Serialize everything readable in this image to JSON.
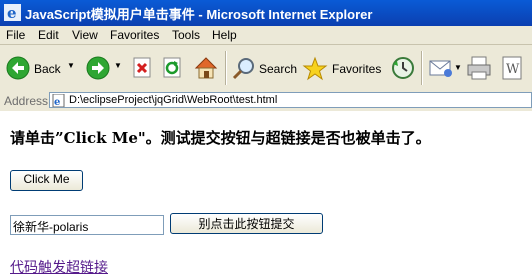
{
  "window": {
    "title": "JavaScript模拟用户单击事件 - Microsoft Internet Explorer",
    "title_icon": "ie-icon"
  },
  "menu": [
    "File",
    "Edit",
    "View",
    "Favorites",
    "Tools",
    "Help"
  ],
  "toolbar": {
    "back_label": "Back",
    "search_label": "Search",
    "favorites_label": "Favorites"
  },
  "address": {
    "label": "Address",
    "url": "D:\\eclipseProject\\jqGrid\\WebRoot\\test.html"
  },
  "page": {
    "heading": "请单击”Click Me\"。测试提交按钮与超链接是否也被单击了。",
    "click_button": "Click Me",
    "input_value": "徐新华-polaris",
    "submit_button": "别点击此按钮提交",
    "link_text": "代码触发超链接"
  }
}
